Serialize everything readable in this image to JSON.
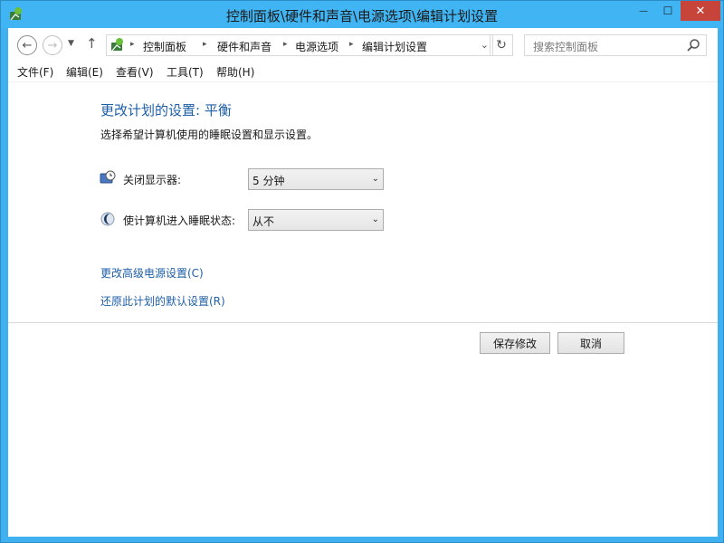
{
  "window": {
    "title": "控制面板\\硬件和声音\\电源选项\\编辑计划设置",
    "app_icon": "control-panel-icon",
    "close_glyph": "✕",
    "minimize_glyph": "—",
    "maximize_glyph": "☐"
  },
  "navigation": {
    "back_glyph": "←",
    "forward_glyph": "→",
    "dropdown_glyph": "▼",
    "up_glyph": "↑",
    "breadcrumbs": [
      "控制面板",
      "硬件和声音",
      "电源选项",
      "编辑计划设置"
    ],
    "separator_glyph": "▸",
    "address_dropdown_glyph": "⌄",
    "refresh_glyph": "↻",
    "search_placeholder": "搜索控制面板"
  },
  "menu": {
    "items": [
      "文件(F)",
      "编辑(E)",
      "查看(V)",
      "工具(T)",
      "帮助(H)"
    ]
  },
  "main": {
    "heading": "更改计划的设置: 平衡",
    "subtitle": "选择希望计算机使用的睡眠设置和显示设置。",
    "settings": [
      {
        "label": "关闭显示器:",
        "icon": "monitor-clock-icon",
        "value": "5 分钟"
      },
      {
        "label": "使计算机进入睡眠状态:",
        "icon": "moon-icon",
        "value": "从不"
      }
    ],
    "select_arrow_glyph": "⌄",
    "links": [
      "更改高级电源设置(C)",
      "还原此计划的默认设置(R)"
    ],
    "buttons": {
      "save": "保存修改",
      "cancel": "取消"
    }
  },
  "colors": {
    "title_bar": "#41b5f3",
    "close_button": "#c7443b",
    "heading": "#1e5fa8",
    "link": "#1e5fa8"
  }
}
